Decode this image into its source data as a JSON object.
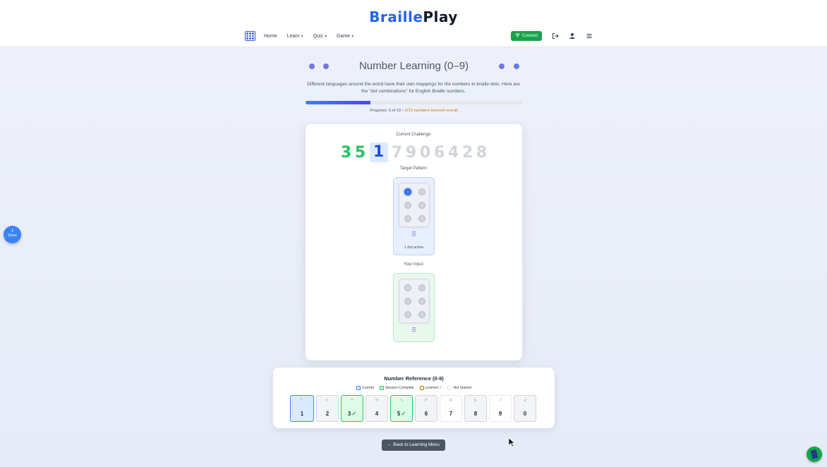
{
  "brand": {
    "part1": "Braille",
    "part2": "Play"
  },
  "nav": {
    "home": "Home",
    "learn": "Learn",
    "quiz": "Quiz",
    "game": "Game",
    "connect": "Connect"
  },
  "icons": {
    "logo": "braille-grid-icon",
    "logout": "logout-icon",
    "user": "user-icon",
    "menu": "hamburger-menu-icon",
    "wifi": "wifi-icon"
  },
  "page": {
    "title": "Number Learning (0–9)",
    "subtitle": "Different languages around the world have their own mappings for the numbers to braille dots. Here are the \"dot combinations\" for English Braille numbers.",
    "progress_label": "Progress: 3 of 10",
    "progress_fraction": 0.3,
    "learned_label": "• 2/10 numbers learned overall"
  },
  "challenge": {
    "label": "Current Challenge:",
    "digits": [
      {
        "value": "3",
        "state": "done"
      },
      {
        "value": "5",
        "state": "done"
      },
      {
        "value": "1",
        "state": "current"
      },
      {
        "value": "7",
        "state": "pending"
      },
      {
        "value": "9",
        "state": "pending"
      },
      {
        "value": "0",
        "state": "pending"
      },
      {
        "value": "6",
        "state": "pending"
      },
      {
        "value": "4",
        "state": "pending"
      },
      {
        "value": "2",
        "state": "pending"
      },
      {
        "value": "8",
        "state": "pending"
      }
    ]
  },
  "target": {
    "label": "Target Pattern:",
    "active_dots": [
      1
    ],
    "braille_char": "⠿",
    "caption": "1 dot active"
  },
  "input": {
    "label": "Your Input:",
    "active_dots": [],
    "braille_char": "⠿"
  },
  "reference": {
    "title": "Number Reference (0-9)",
    "legend": [
      {
        "label": "Current",
        "color": "#dbeafe",
        "border": "#3b82f6"
      },
      {
        "label": "Session Complete",
        "color": "#dcfce7",
        "border": "#22c55e"
      },
      {
        "label": "Learned ✓",
        "color": "#fef3c7",
        "border": "#d97706"
      },
      {
        "label": "Not Started",
        "color": "#ffffff",
        "border": "#e5e7eb"
      }
    ],
    "tiles": [
      {
        "num": "1",
        "braille": "⠁",
        "state": "current",
        "check": ""
      },
      {
        "num": "2",
        "braille": "⠃",
        "state": "neutral",
        "check": ""
      },
      {
        "num": "3",
        "braille": "⠉",
        "state": "session",
        "check": "✓"
      },
      {
        "num": "4",
        "braille": "⠙",
        "state": "neutral",
        "check": ""
      },
      {
        "num": "5",
        "braille": "⠑",
        "state": "session",
        "check": "✓"
      },
      {
        "num": "6",
        "braille": "⠋",
        "state": "neutral",
        "check": ""
      },
      {
        "num": "7",
        "braille": "⠛",
        "state": "notstarted",
        "check": ""
      },
      {
        "num": "8",
        "braille": "⠓",
        "state": "neutral",
        "check": ""
      },
      {
        "num": "9",
        "braille": "⠊",
        "state": "notstarted",
        "check": ""
      },
      {
        "num": "0",
        "braille": "⠚",
        "state": "neutral",
        "check": ""
      }
    ]
  },
  "back_button": "← Back to Learning Menu",
  "side_toggle": {
    "icon": "‖",
    "label": "Show"
  },
  "colors": {
    "accent": "#3b82f6",
    "success": "#22c55e",
    "brand_blue": "#2563eb"
  }
}
